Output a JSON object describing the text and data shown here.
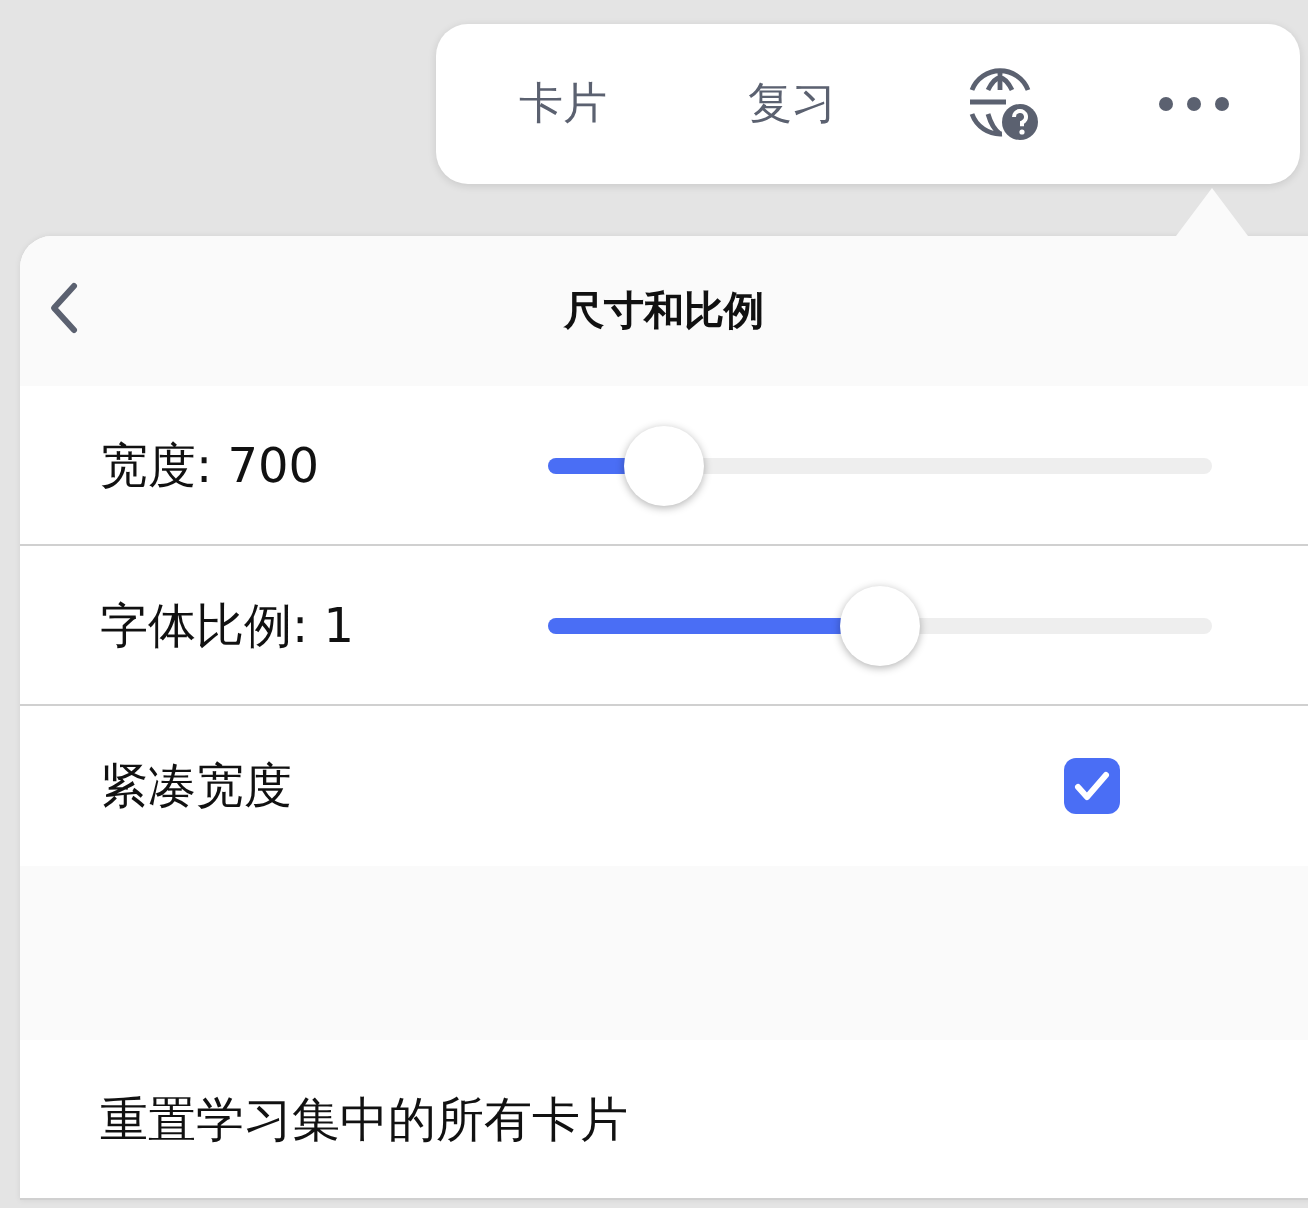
{
  "toolbar": {
    "items": [
      {
        "kind": "text",
        "label": "卡片"
      },
      {
        "kind": "text",
        "label": "复习"
      },
      {
        "kind": "globe"
      },
      {
        "kind": "more"
      }
    ]
  },
  "panel": {
    "title": "尺寸和比例",
    "settings": [
      {
        "kind": "slider",
        "label": "宽度: 700",
        "level": 0.175
      },
      {
        "kind": "slider",
        "label": "字体比例: 1",
        "level": 0.5
      },
      {
        "kind": "checkbox",
        "label": "紧凑宽度",
        "checked": true
      }
    ],
    "actions": [
      {
        "label": "重置学习集中的所有卡片"
      }
    ]
  }
}
